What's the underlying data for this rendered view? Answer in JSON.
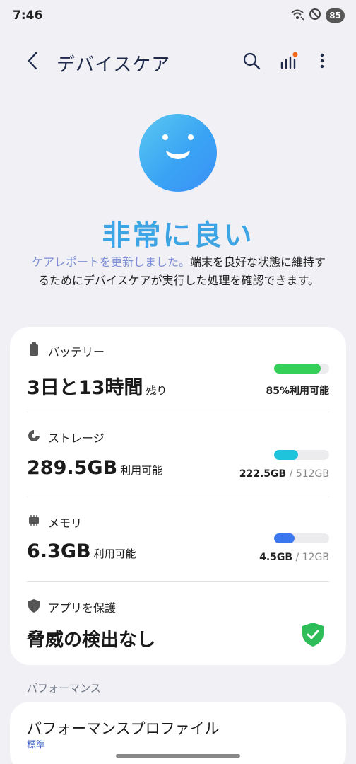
{
  "status_bar": {
    "time": "7:46",
    "battery": "85"
  },
  "app_bar": {
    "title": "デバイスケア",
    "icons": [
      "back-icon",
      "search-icon",
      "stats-icon",
      "more-icon"
    ],
    "notification_dot_color": "#f26b1d"
  },
  "summary": {
    "status": "非常に良い",
    "link_text": "ケアレポートを更新しました。",
    "description": "端末を良好な状態に維持するためにデバイスケアが実行した処理を確認できます。"
  },
  "battery": {
    "label": "バッテリー",
    "value": "3日と13時間",
    "value_suffix": "残り",
    "right_text": "85%利用可能",
    "level": 0.85,
    "color": "#34d058"
  },
  "storage": {
    "label": "ストレージ",
    "value": "289.5GB",
    "value_suffix": "利用可能",
    "used": "222.5GB",
    "separator": " / ",
    "total": "512GB",
    "level": 0.43,
    "color": "#1fc4dc"
  },
  "memory": {
    "label": "メモリ",
    "value": "6.3GB",
    "value_suffix": "利用可能",
    "used": "4.5GB",
    "separator": " / ",
    "total": "12GB",
    "level": 0.37,
    "color": "#3b78f0"
  },
  "protection": {
    "label": "アプリを保護",
    "value": "脅威の検出なし",
    "shield_color": "#2ebd59"
  },
  "performance": {
    "section_title": "パフォーマンス",
    "title": "パフォーマンスプロファイル",
    "subtitle": "標準"
  }
}
